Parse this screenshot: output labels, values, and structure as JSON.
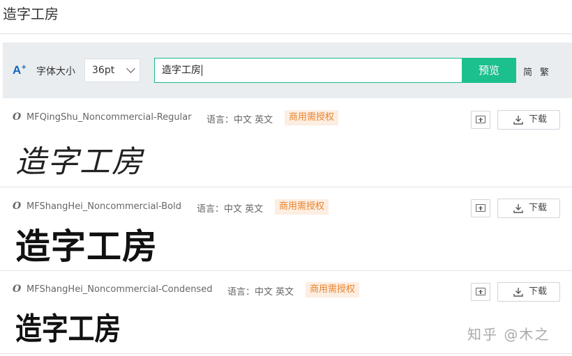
{
  "header": {
    "title": "造字工房"
  },
  "toolbar": {
    "size_label": "字体大小",
    "size_value": "36pt",
    "preview_text": "造字工房",
    "preview_button": "预览",
    "simplified": "简",
    "traditional": "繁"
  },
  "fonts": [
    {
      "name": "MFQingShu_Noncommercial-Regular",
      "language": "语言：中文 英文",
      "license": "商用需授权",
      "download": "下载",
      "sample": "造字工房"
    },
    {
      "name": "MFShangHei_Noncommercial-Bold",
      "language": "语言：中文 英文",
      "license": "商用需授权",
      "download": "下载",
      "sample": "造字工房"
    },
    {
      "name": "MFShangHei_Noncommercial-Condensed",
      "language": "语言：中文 英文",
      "license": "商用需授权",
      "download": "下载",
      "sample": "造字工房"
    }
  ],
  "watermark": "知乎 @木之",
  "colors": {
    "accent": "#1cbf8e",
    "badge_bg": "#fdeee2",
    "badge_text": "#e8842c",
    "toolbar_bg": "#eaedf0"
  },
  "icons": [
    "font-size-icon",
    "chevron-down-icon",
    "font-type-icon",
    "add-folder-icon",
    "download-icon"
  ]
}
